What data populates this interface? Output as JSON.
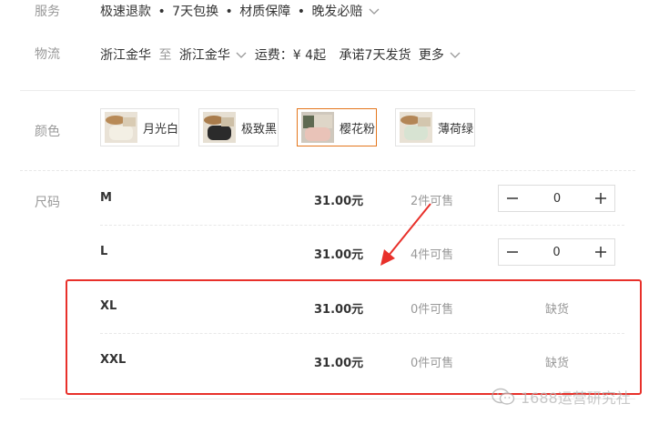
{
  "service": {
    "label": "服务",
    "items": [
      "极速退款",
      "7天包换",
      "材质保障",
      "晚发必赔"
    ],
    "separator": "•"
  },
  "logistics": {
    "label": "物流",
    "from": "浙江金华",
    "to_word": "至",
    "to": "浙江金华",
    "fee": "运费：¥ 4起",
    "promise": "承诺7天发货",
    "more": "更多"
  },
  "color": {
    "label": "颜色",
    "options": [
      {
        "name": "月光白",
        "selected": false
      },
      {
        "name": "极致黑",
        "selected": false
      },
      {
        "name": "樱花粉",
        "selected": true
      },
      {
        "name": "薄荷绿",
        "selected": false
      }
    ]
  },
  "size": {
    "label": "尺码",
    "rows": [
      {
        "size": "M",
        "price": "31.00元",
        "stock": "2件可售",
        "qty": "0",
        "out_of_stock": false
      },
      {
        "size": "L",
        "price": "31.00元",
        "stock": "4件可售",
        "qty": "0",
        "out_of_stock": false
      },
      {
        "size": "XL",
        "price": "31.00元",
        "stock": "0件可售",
        "status": "缺货",
        "out_of_stock": true
      },
      {
        "size": "XXL",
        "price": "31.00元",
        "stock": "0件可售",
        "status": "缺货",
        "out_of_stock": true
      }
    ]
  },
  "watermark": "1688运营研究社",
  "colors": {
    "highlight_red": "#e8302a",
    "selected_orange": "#e4761d"
  }
}
